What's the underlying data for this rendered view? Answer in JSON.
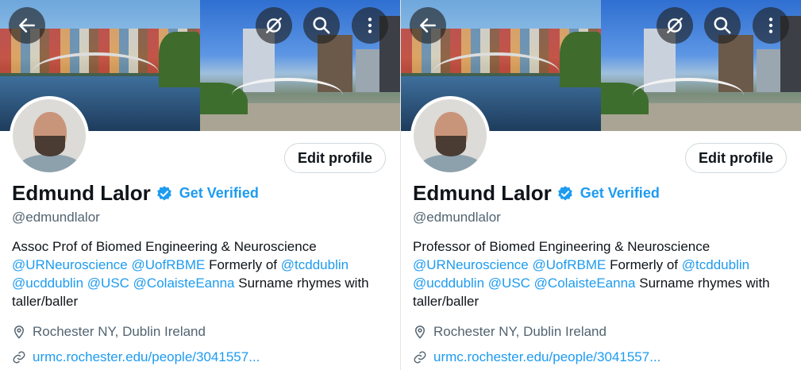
{
  "colors": {
    "accent": "#1d9bf0",
    "text": "#0f1419",
    "secondary": "#536471"
  },
  "profiles": [
    {
      "header_buttons": {
        "back_icon": "arrow-left-icon",
        "mute_icon": "eye-slash-icon",
        "search_icon": "search-icon",
        "more_icon": "more-vertical-icon"
      },
      "edit_label": "Edit profile",
      "name": "Edmund Lalor",
      "verified_label": "Get Verified",
      "handle": "@edmundlalor",
      "bio_line1": "Assoc Prof of Biomed Engineering & Neuroscience",
      "mention1": "@URNeuroscience",
      "mention2": "@UofRBME",
      "formerly": "Formerly of",
      "mention3": "@tcddublin",
      "mention4": "@ucddublin",
      "mention5": "@USC",
      "mention6": "@ColaisteEanna",
      "bio_tail": "Surname rhymes with taller/baller",
      "location": "Rochester NY, Dublin Ireland",
      "url": "urmc.rochester.edu/people/3041557..."
    },
    {
      "header_buttons": {
        "back_icon": "arrow-left-icon",
        "mute_icon": "eye-slash-icon",
        "search_icon": "search-icon",
        "more_icon": "more-vertical-icon"
      },
      "edit_label": "Edit profile",
      "name": "Edmund Lalor",
      "verified_label": "Get Verified",
      "handle": "@edmundlalor",
      "bio_line1": "Professor of Biomed Engineering & Neuroscience",
      "mention1": "@URNeuroscience",
      "mention2": "@UofRBME",
      "formerly": "Formerly of",
      "mention3": "@tcddublin",
      "mention4": "@ucddublin",
      "mention5": "@USC",
      "mention6": "@ColaisteEanna",
      "bio_tail": "Surname rhymes with taller/baller",
      "location": "Rochester NY, Dublin Ireland",
      "url": "urmc.rochester.edu/people/3041557..."
    }
  ]
}
